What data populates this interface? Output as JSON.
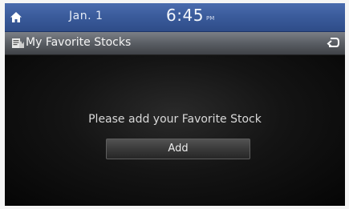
{
  "status_bar": {
    "home_icon": "home-icon",
    "date": "Jan. 1",
    "time": "6:45",
    "ampm": "PM"
  },
  "title_bar": {
    "icon": "stocks-icon",
    "title": "My Favorite Stocks",
    "back_icon": "back-arrow-icon"
  },
  "main": {
    "message": "Please add your Favorite Stock",
    "add_button_label": "Add"
  },
  "colors": {
    "status_bar": "#3b5c9c",
    "title_bar": "#5a5e64",
    "background": "#000000"
  }
}
